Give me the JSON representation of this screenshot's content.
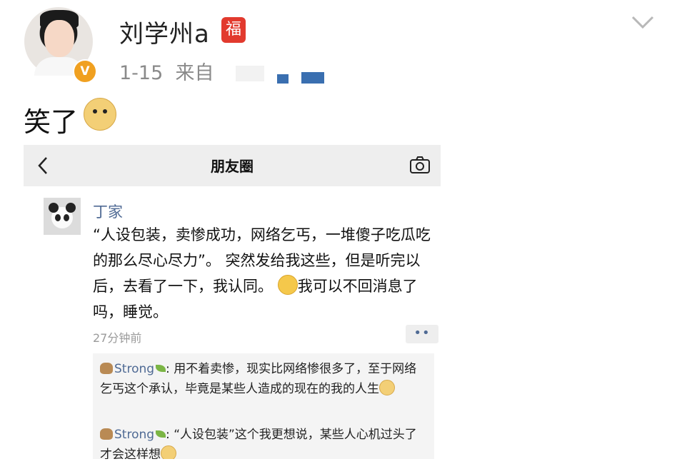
{
  "post": {
    "author": "刘学州a",
    "badge": "福",
    "verified_badge": "V",
    "date": "1-15",
    "source_prefix": "来自",
    "text": "笑了",
    "emoji": "doge-emoji"
  },
  "embedded_screenshot": {
    "title": "朋友圈",
    "back_icon": "chevron-left-icon",
    "camera_icon": "camera-icon",
    "moment": {
      "name": "丁家",
      "text_part1": "“人设包装，卖惨成功，网络乞丐，一堆傻子吃瓜吃的那么尽心尽力”。 突然发给我这些，但是听完以后，去看了一下，我认同。",
      "text_part2": "我可以不回消息了吗，睡觉。",
      "time": "27分钟前",
      "more_label": "••"
    },
    "comments": [
      {
        "name": "Strong",
        "separator": ":",
        "text": "用不着卖惨，现实比网络惨很多了，至于网络乞丐这个承认，毕竟是某些人造成的现在的我的人生"
      },
      {
        "name": "Strong",
        "separator": ":",
        "text": "“人设包装”这个我更想说，某些人心机过头了才会这样想"
      }
    ]
  }
}
